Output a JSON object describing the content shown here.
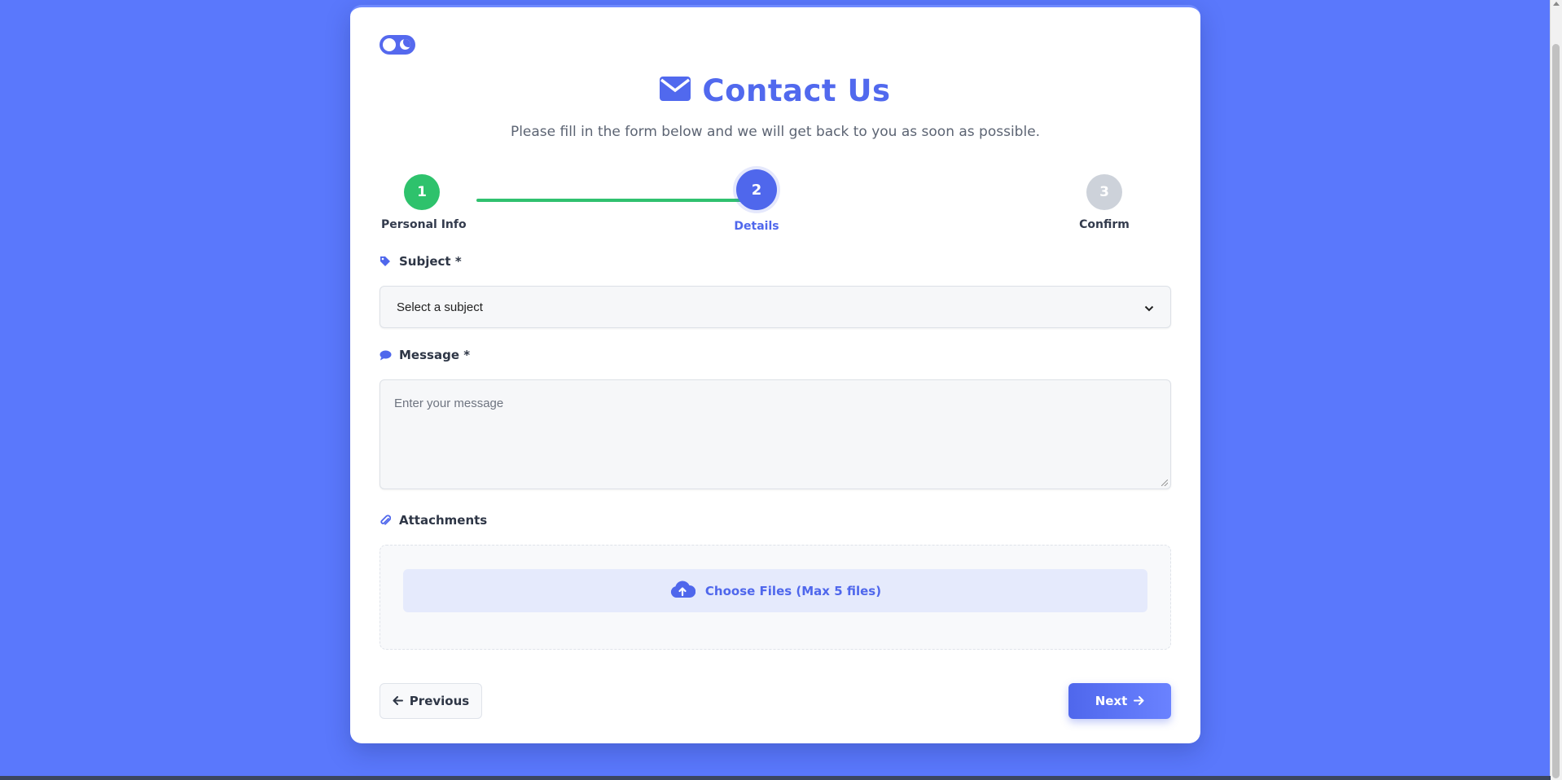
{
  "header": {
    "title": "Contact Us",
    "subtitle": "Please fill in the form below and we will get back to you as soon as possible."
  },
  "stepper": {
    "steps": [
      {
        "number": "1",
        "label": "Personal Info",
        "state": "completed"
      },
      {
        "number": "2",
        "label": "Details",
        "state": "active"
      },
      {
        "number": "3",
        "label": "Confirm",
        "state": "pending"
      }
    ]
  },
  "form": {
    "subject": {
      "label": "Subject *",
      "selected": "Select a subject",
      "icon": "tag-icon"
    },
    "message": {
      "label": "Message *",
      "placeholder": "Enter your message",
      "value": "",
      "icon": "comment-icon"
    },
    "attachments": {
      "label": "Attachments",
      "button_label": "Choose Files (Max 5 files)",
      "icon": "paperclip-icon"
    }
  },
  "nav": {
    "previous_label": "Previous",
    "next_label": "Next"
  },
  "colors": {
    "page_background": "#5a78fc",
    "accent": "#4f67ec",
    "success": "#2ec26c",
    "pending": "#cdd2da"
  }
}
